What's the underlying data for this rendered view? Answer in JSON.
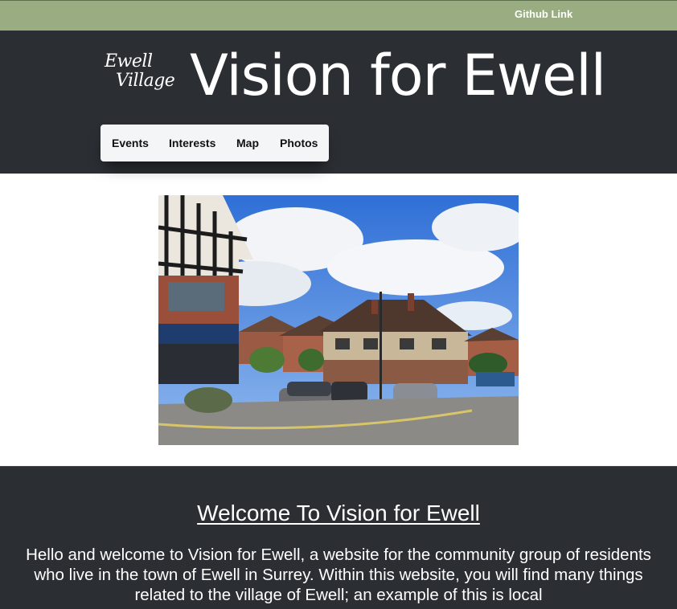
{
  "topbar": {
    "github_link": "Github Link"
  },
  "header": {
    "logo_line1": "Ewell",
    "logo_line2": "Village",
    "title": "Vision for Ewell"
  },
  "nav": {
    "items": [
      "Events",
      "Interests",
      "Map",
      "Photos"
    ]
  },
  "welcome": {
    "heading": "Welcome To Vision for Ewell",
    "body": "Hello and welcome to Vision for Ewell, a website for the community group of residents who live in the town of Ewell in Surrey. Within this website, you will find many things related to the village of Ewell; an example of this is local"
  },
  "colors": {
    "topbar_bg": "#9aad82",
    "header_bg": "#2b2f33",
    "nav_bg": "#f4f5f7"
  }
}
